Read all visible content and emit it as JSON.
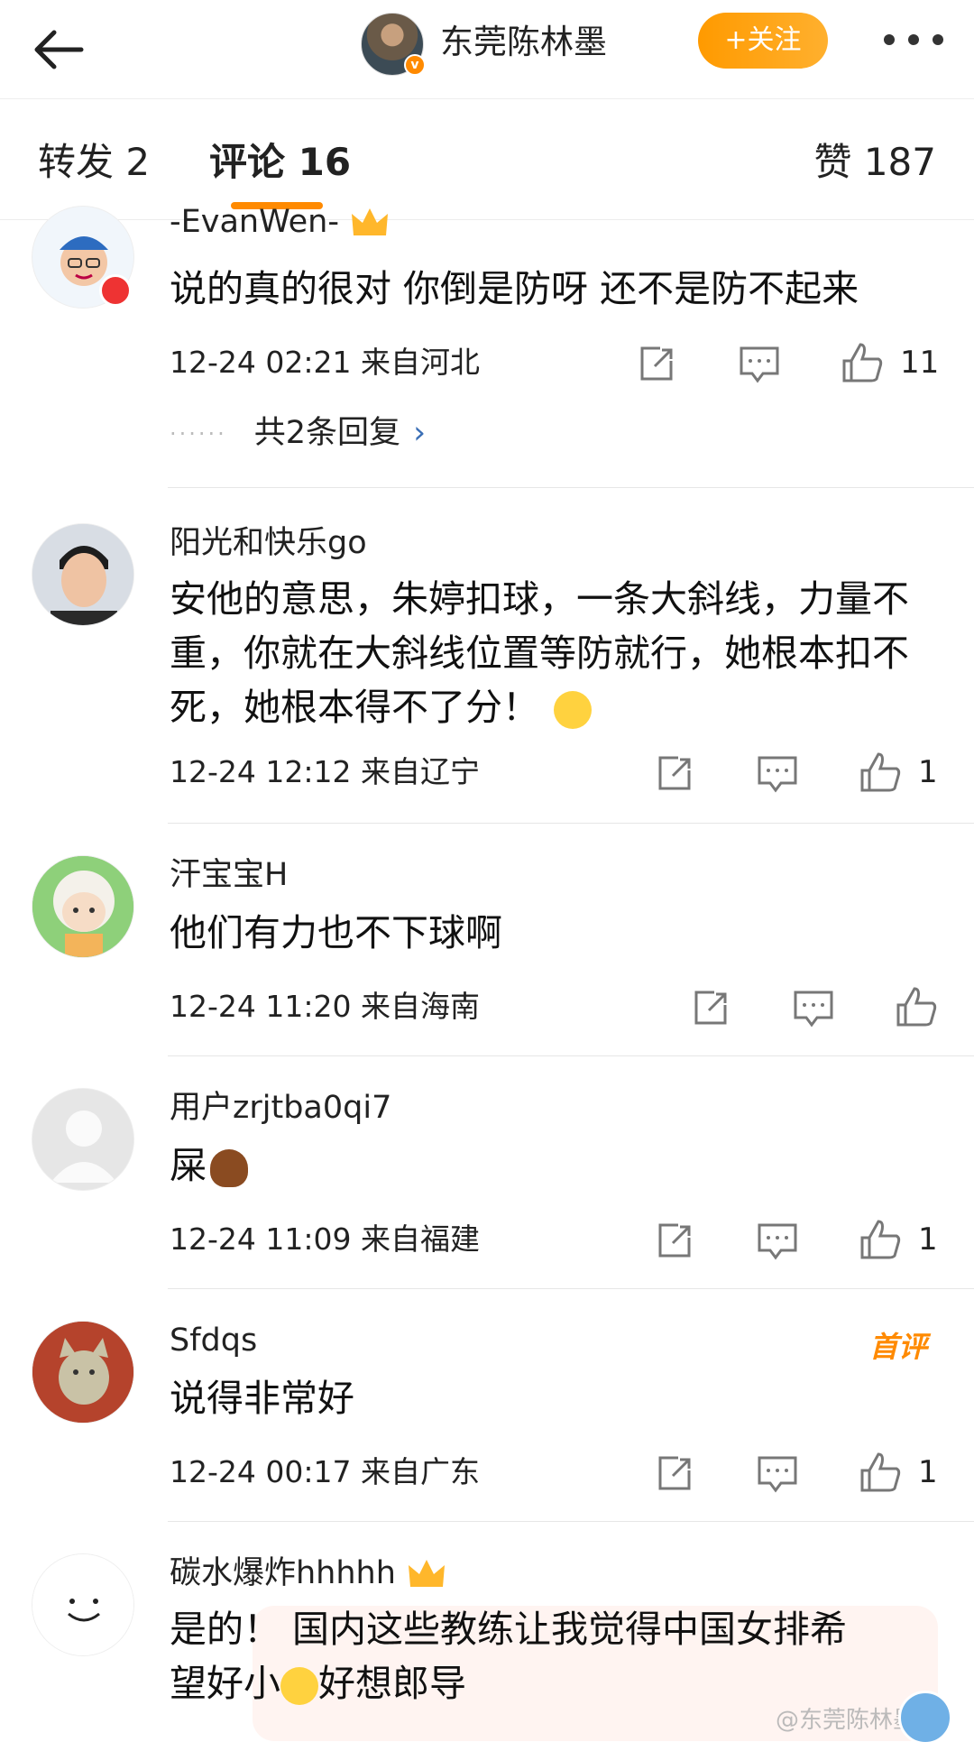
{
  "header": {
    "title": "东莞陈林墨",
    "follow_label": "+关注",
    "verified_badge": "v"
  },
  "tabs": {
    "repost": "转发 2",
    "comment": "评论 16",
    "like": "赞 187"
  },
  "comments": [
    {
      "user": "-EvanWen-",
      "text": "说的真的很对 你倒是防呀 还不是防不起来",
      "time": "12-24 02:21",
      "location": "来自河北",
      "likes": "11",
      "replies": "共2条回复"
    },
    {
      "user": "阳光和快乐go",
      "text": "安他的意思，朱婷扣球，一条大斜线，力量不重，你就在大斜线位置等防就行，她根本扣不死，她根本得不了分！",
      "time": "12-24 12:12",
      "location": "来自辽宁",
      "likes": "1"
    },
    {
      "user": "汗宝宝H",
      "text": "他们有力也不下球啊",
      "time": "12-24 11:20",
      "location": "来自海南",
      "likes": ""
    },
    {
      "user": "用户zrjtba0qi7",
      "text": "屎",
      "time": "12-24 11:09",
      "location": "来自福建",
      "likes": "1"
    },
    {
      "user": "Sfdqs",
      "text": "说得非常好",
      "time": "12-24 00:17",
      "location": "来自广东",
      "likes": "1",
      "tag": "首评"
    },
    {
      "user": "碳水爆炸hhhhh",
      "text_line1": "是的！ 国内这些教练让我觉得中国女排希",
      "text_line2a": "望好小",
      "text_line2b": "好想郎导"
    }
  ],
  "watermark": "@东莞陈林墨",
  "colors": {
    "accent": "#ff8a00",
    "link": "#3b6fb6"
  }
}
